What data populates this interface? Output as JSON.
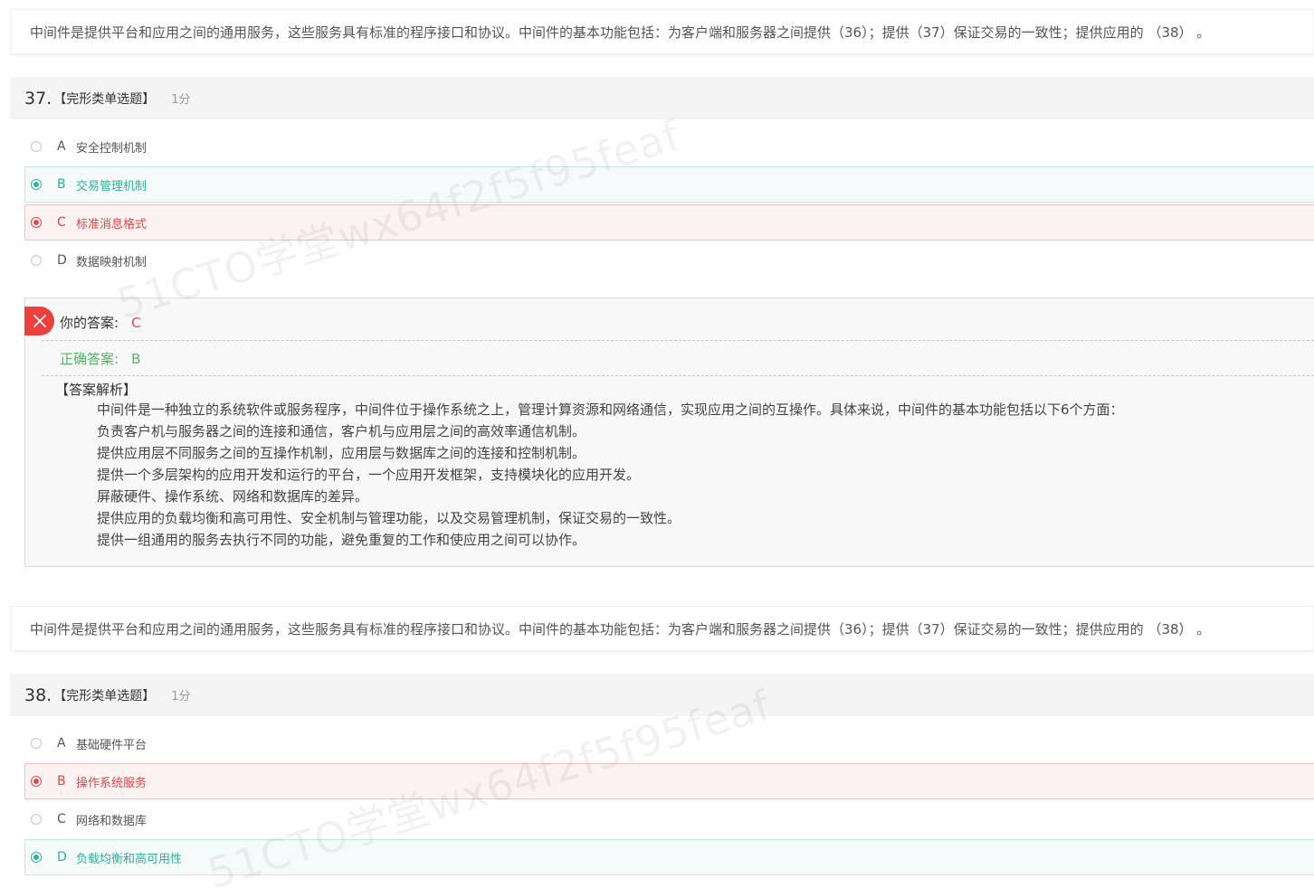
{
  "questions": [
    {
      "stem": "中间件是提供平台和应用之间的通用服务，这些服务具有标准的程序接口和协议。中间件的基本功能包括：为客户端和服务器之间提供（36）；提供（37）保证交易的一致性；提供应用的 （38） 。",
      "number": "37.",
      "type": "【完形类单选题】",
      "score": "1分",
      "options": [
        {
          "letter": "A",
          "text": "安全控制机制"
        },
        {
          "letter": "B",
          "text": "交易管理机制"
        },
        {
          "letter": "C",
          "text": "标准消息格式"
        },
        {
          "letter": "D",
          "text": "数据映射机制"
        }
      ],
      "your_answer_label": "你的答案:",
      "your_answer": "C",
      "correct_answer_label": "正确答案:",
      "correct_answer": "B",
      "analysis_title": "【答案解析】",
      "analysis_lines": [
        "中间件是一种独立的系统软件或服务程序，中间件位于操作系统之上，管理计算资源和网络通信，实现应用之间的互操作。具体来说，中间件的基本功能包括以下6个方面：",
        "负责客户机与服务器之间的连接和通信，客户机与应用层之间的高效率通信机制。",
        "提供应用层不同服务之间的互操作机制，应用层与数据库之间的连接和控制机制。",
        "提供一个多层架构的应用开发和运行的平台，一个应用开发框架，支持模块化的应用开发。",
        "屏蔽硬件、操作系统、网络和数据库的差异。",
        "提供应用的负载均衡和高可用性、安全机制与管理功能，以及交易管理机制，保证交易的一致性。",
        "提供一组通用的服务去执行不同的功能，避免重复的工作和使应用之间可以协作。"
      ]
    },
    {
      "stem": "中间件是提供平台和应用之间的通用服务，这些服务具有标准的程序接口和协议。中间件的基本功能包括：为客户端和服务器之间提供（36）；提供（37）保证交易的一致性；提供应用的 （38） 。",
      "number": "38.",
      "type": "【完形类单选题】",
      "score": "1分",
      "options": [
        {
          "letter": "A",
          "text": "基础硬件平台"
        },
        {
          "letter": "B",
          "text": "操作系统服务"
        },
        {
          "letter": "C",
          "text": "网络和数据库"
        },
        {
          "letter": "D",
          "text": "负载均衡和高可用性"
        }
      ]
    }
  ],
  "watermark": "51CTO学堂wx64f2f5f95feaf",
  "colors": {
    "correct": "#2cb29a",
    "wrong": "#e04848",
    "correct_label": "#4cbb5e",
    "header_bg": "#f4f4f4"
  },
  "icons": {
    "wrong_badge": "close-icon"
  }
}
